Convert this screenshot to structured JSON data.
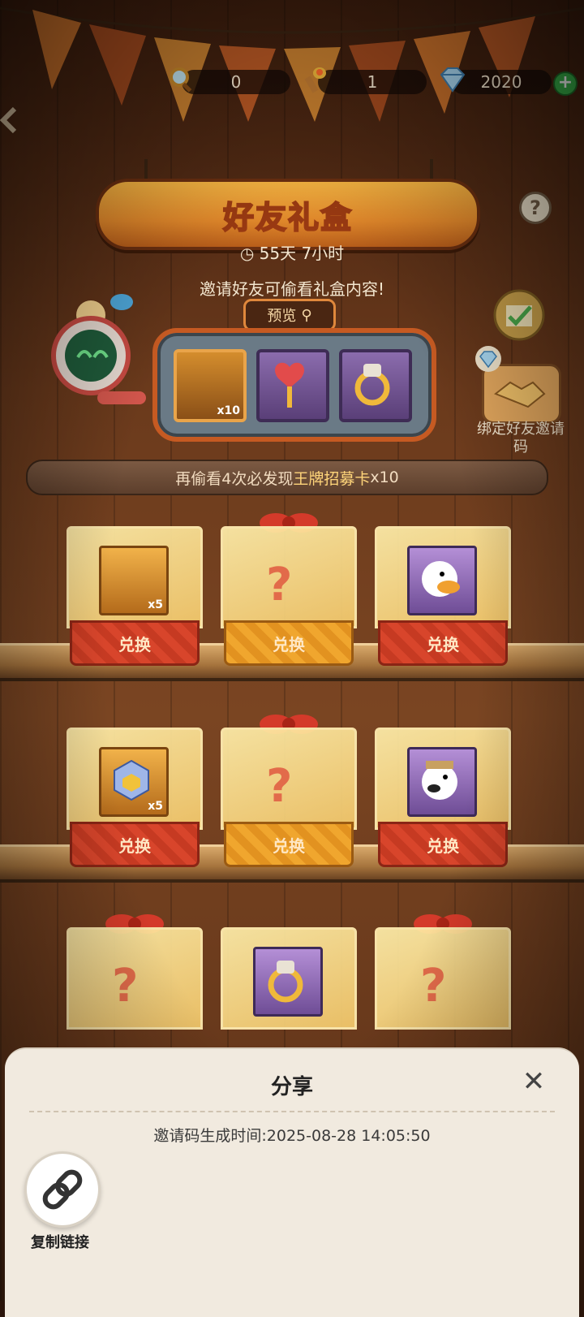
{
  "currencies": [
    {
      "icon": "magnifier-icon",
      "value": "0"
    },
    {
      "icon": "torch-icon",
      "value": "1"
    },
    {
      "icon": "diamond-icon",
      "value": "2020"
    }
  ],
  "header": {
    "title": "好友礼盒",
    "countdown": "55天 7小时",
    "invite_hint": "邀请好友可偷看礼盒内容!",
    "preview_label": "预览"
  },
  "machine_slots": [
    {
      "type": "recruit-card-gold",
      "quantity": "x10"
    },
    {
      "type": "heart-scepter",
      "quantity": ""
    },
    {
      "type": "gold-ring",
      "quantity": ""
    }
  ],
  "bind_friend": {
    "label": "绑定好友邀请码"
  },
  "notice": {
    "prefix": "再偷看4次必发现",
    "highlight": "王牌招募卡",
    "suffix": " x10"
  },
  "shelves": [
    [
      {
        "kind": "item",
        "item": "recruit-card-silver",
        "quantity": "x5",
        "button": "兑换"
      },
      {
        "kind": "mystery",
        "button": "兑换"
      },
      {
        "kind": "item",
        "item": "character-duck-card",
        "quantity": "",
        "button": "兑换"
      }
    ],
    [
      {
        "kind": "item",
        "item": "cube-box",
        "quantity": "x5",
        "button": "兑换"
      },
      {
        "kind": "mystery",
        "button": "兑换"
      },
      {
        "kind": "item",
        "item": "character-dog-card",
        "quantity": "",
        "button": "兑换"
      }
    ],
    [
      {
        "kind": "mystery",
        "button": ""
      },
      {
        "kind": "item",
        "item": "gold-ring",
        "quantity": "",
        "button": ""
      },
      {
        "kind": "mystery",
        "button": ""
      }
    ]
  ],
  "share_panel": {
    "title": "分享",
    "generated_time": "邀请码生成时间:2025-08-28  14:05:50",
    "copy_label": "复制链接"
  },
  "colors": {
    "accent": "#e3892b",
    "exchange_red": "#d8452b",
    "exchange_gold": "#f0a62e",
    "panel": "#f1eadf"
  }
}
